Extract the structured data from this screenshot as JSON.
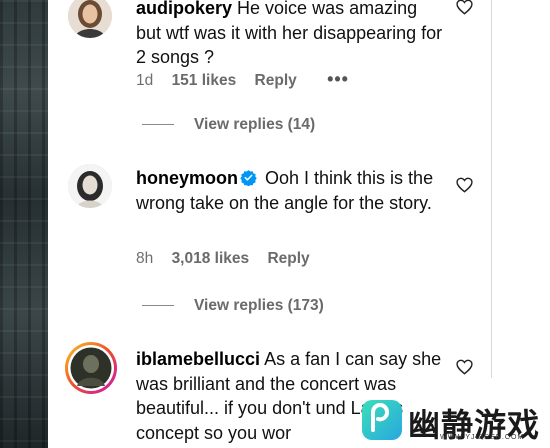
{
  "comments": [
    {
      "username": "audipokery",
      "text": " He voice was amazing but wtf was it with her disappearing for 2 songs ?",
      "time": "1d",
      "likes": "151 likes",
      "reply_label": "Reply",
      "more_label": "•••",
      "view_replies": "View replies (14)"
    },
    {
      "username": "honeymoon",
      "verified": true,
      "text": " Ooh I think this is the wrong take on the angle for the story.",
      "time": "8h",
      "likes": "3,018 likes",
      "reply_label": "Reply",
      "view_replies": "View replies (173)"
    },
    {
      "username": "iblamebellucci",
      "text": " As a fan I can say she was brilliant and the concert was beautiful... if you don't und Lana's concept so you wor"
    }
  ],
  "icons": {
    "heart": "heart-icon",
    "verified": "verified-badge-icon"
  },
  "colors": {
    "verified": "#0095f6",
    "meta_text": "#6f6f6f",
    "story_ring_start": "#f9c823",
    "story_ring_end": "#c913b9"
  },
  "watermark": {
    "text": "幽静游戏",
    "url": "WWW.YJISREN.COM"
  }
}
